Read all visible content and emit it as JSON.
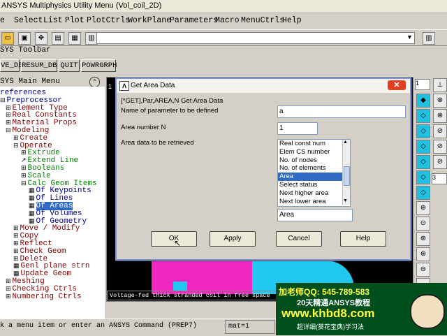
{
  "window": {
    "title": "ANSYS Multiphysics Utility Menu (Vol_coil_2D)"
  },
  "menu": [
    "Select",
    "List",
    "Plot",
    "PlotCtrls",
    "WorkPlane",
    "Parameters",
    "Macro",
    "MenuCtrls",
    "Help"
  ],
  "menu_first_partial": "e",
  "toolbar_title": "SYS Toolbar",
  "toolbar_buttons": [
    "VE_DB",
    "RESUM_DB",
    "QUIT",
    "POWRGRPH"
  ],
  "main_menu_title": "SYS Main Menu",
  "tree": [
    {
      "label": "references",
      "indent": 0,
      "icon": "",
      "color": "#000080"
    },
    {
      "label": "Preprocessor",
      "indent": 0,
      "icon": "minus",
      "color": "#000080"
    },
    {
      "label": "Element Type",
      "indent": 1,
      "icon": "plus",
      "color": "#800000"
    },
    {
      "label": "Real Constants",
      "indent": 1,
      "icon": "plus",
      "color": "#800000"
    },
    {
      "label": "Material Props",
      "indent": 1,
      "icon": "plus",
      "color": "#800000"
    },
    {
      "label": "Modeling",
      "indent": 1,
      "icon": "minus",
      "color": "#800000"
    },
    {
      "label": "Create",
      "indent": 2,
      "icon": "plus",
      "color": "#800000"
    },
    {
      "label": "Operate",
      "indent": 2,
      "icon": "minus",
      "color": "#800000"
    },
    {
      "label": "Extrude",
      "indent": 3,
      "icon": "plus",
      "color": "#008000"
    },
    {
      "label": "Extend Line",
      "indent": 3,
      "icon": "tool",
      "color": "#008000"
    },
    {
      "label": "Booleans",
      "indent": 3,
      "icon": "plus",
      "color": "#008000"
    },
    {
      "label": "Scale",
      "indent": 3,
      "icon": "plus",
      "color": "#008000"
    },
    {
      "label": "Calc Geom Items",
      "indent": 3,
      "icon": "minus",
      "color": "#008000"
    },
    {
      "label": "Of Keypoints",
      "indent": 4,
      "icon": "grid",
      "color": "#000080"
    },
    {
      "label": "Of Lines",
      "indent": 4,
      "icon": "grid",
      "color": "#000080"
    },
    {
      "label": "Of Areas",
      "indent": 4,
      "icon": "grid",
      "color": "#ffffff",
      "selected": true
    },
    {
      "label": "Of Volumes",
      "indent": 4,
      "icon": "grid",
      "color": "#000080"
    },
    {
      "label": "Of Geometry",
      "indent": 4,
      "icon": "grid",
      "color": "#000080"
    },
    {
      "label": "Move / Modify",
      "indent": 2,
      "icon": "plus",
      "color": "#800000"
    },
    {
      "label": "Copy",
      "indent": 2,
      "icon": "plus",
      "color": "#800000"
    },
    {
      "label": "Reflect",
      "indent": 2,
      "icon": "plus",
      "color": "#800000"
    },
    {
      "label": "Check Geom",
      "indent": 2,
      "icon": "plus",
      "color": "#800000"
    },
    {
      "label": "Delete",
      "indent": 2,
      "icon": "plus",
      "color": "#800000"
    },
    {
      "label": "Genl plane strn",
      "indent": 2,
      "icon": "grid",
      "color": "#800000"
    },
    {
      "label": "Update Geom",
      "indent": 2,
      "icon": "grid",
      "color": "#800000"
    },
    {
      "label": "Meshing",
      "indent": 1,
      "icon": "plus",
      "color": "#800000"
    },
    {
      "label": "Checking Ctrls",
      "indent": 1,
      "icon": "plus",
      "color": "#800000"
    },
    {
      "label": "Numbering Ctrls",
      "indent": 1,
      "icon": "plus",
      "color": "#800000"
    }
  ],
  "dialog": {
    "title": "Get Area Data",
    "command": "[*GET],Par,AREA,N   Get Area Data",
    "param_label": "Name of parameter to be defined",
    "param_value": "a",
    "area_label": "Area number N",
    "area_value": "1",
    "data_label": "Area data to be retrieved",
    "list": [
      "Real const num",
      "Elem CS number",
      "No. of nodes",
      "No. of elements",
      "Area",
      "Select status",
      "Next higher area",
      "Next lower area"
    ],
    "selected_index": 4,
    "selected_value": "Area",
    "ok": "OK",
    "apply": "Apply",
    "cancel": "Cancel",
    "help": "Help"
  },
  "graphics": {
    "number": "1",
    "caption": "Voltage-fed thick stranded coil in free space"
  },
  "right_toolbar": {
    "combo1": "1",
    "combo2": "3"
  },
  "status": {
    "prompt": "k a menu item or enter an ANSYS Command (PREP7)",
    "mat": "mat=1"
  },
  "ad": {
    "line1": "加老师QQ: 545-789-583",
    "line2": "20天精通ANSYS教程",
    "line3": "www.khbd8.com",
    "line4": "超详细(葵花宝典)学习法"
  }
}
